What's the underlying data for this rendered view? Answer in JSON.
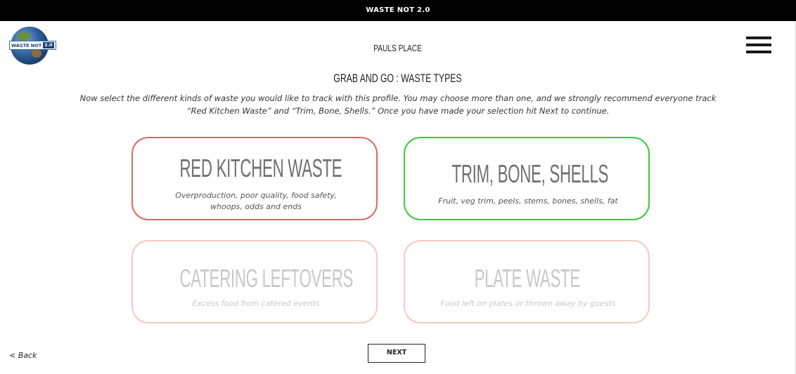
{
  "app": {
    "title": "WASTE NOT 2.0",
    "logo_text": "WASTE NOT",
    "logo_version": "2.0"
  },
  "header": {
    "place_name": "PAULS PLACE",
    "menu_icon": "hamburger-menu-icon"
  },
  "page": {
    "heading": "GRAB AND GO : WASTE TYPES",
    "intro": "Now select the different kinds of waste you would like to track with this profile. You may choose more than one, and we strongly recommend everyone track “Red Kitchen Waste” and “Trim, Bone, Shells.” Once you have made your selection hit Next to continue."
  },
  "waste_types": [
    {
      "title": "RED KITCHEN WASTE",
      "description": "Overproduction, poor quality, food safety, whoops, odds and ends",
      "border_color": "#d86a62",
      "state": "active"
    },
    {
      "title": "TRIM, BONE, SHELLS",
      "description": "Fruit, veg trim, peels, stems, bones, shells, fat",
      "border_color": "#3cc83c",
      "state": "selected"
    },
    {
      "title": "CATERING LEFTOVERS",
      "description": "Excess food from catered events",
      "border_color": "#f3c9c4",
      "state": "dimmed"
    },
    {
      "title": "PLATE WASTE",
      "description": "Food left on plates or thrown away by guests",
      "border_color": "#f3c9c4",
      "state": "dimmed"
    }
  ],
  "footer": {
    "back_label": "< Back",
    "next_label": "NEXT"
  }
}
